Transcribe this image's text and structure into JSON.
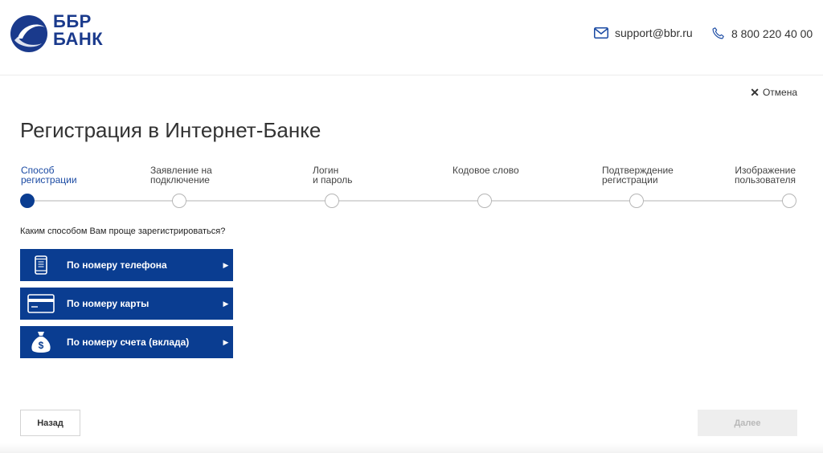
{
  "header": {
    "logo": {
      "line1": "ББР",
      "line2": "БАНК"
    },
    "email": "support@bbr.ru",
    "phone": "8 800 220 40 00"
  },
  "cancel_label": "Отмена",
  "title": "Регистрация в Интернет-Банке",
  "steps": [
    {
      "line1": "Способ",
      "line2": "регистрации",
      "active": true
    },
    {
      "line1": "Заявление на",
      "line2": "подключение",
      "active": false
    },
    {
      "line1": "Логин",
      "line2": "и пароль",
      "active": false
    },
    {
      "line1": "Кодовое слово",
      "line2": "",
      "active": false
    },
    {
      "line1": "Подтверждение",
      "line2": "регистрации",
      "active": false
    },
    {
      "line1": "Изображение",
      "line2": "пользователя",
      "active": false
    }
  ],
  "question": "Каким способом Вам проще зарегистрироваться?",
  "options": [
    {
      "label": "По номеру телефона",
      "icon": "phone-icon"
    },
    {
      "label": "По номеру карты",
      "icon": "card-icon"
    },
    {
      "label": "По номеру счета (вклада)",
      "icon": "money-bag-icon"
    }
  ],
  "buttons": {
    "back": "Назад",
    "next": "Далее"
  },
  "colors": {
    "brand": "#0a3d91",
    "logo": "#1a3a8c",
    "disabled_bg": "#eeeeee"
  }
}
